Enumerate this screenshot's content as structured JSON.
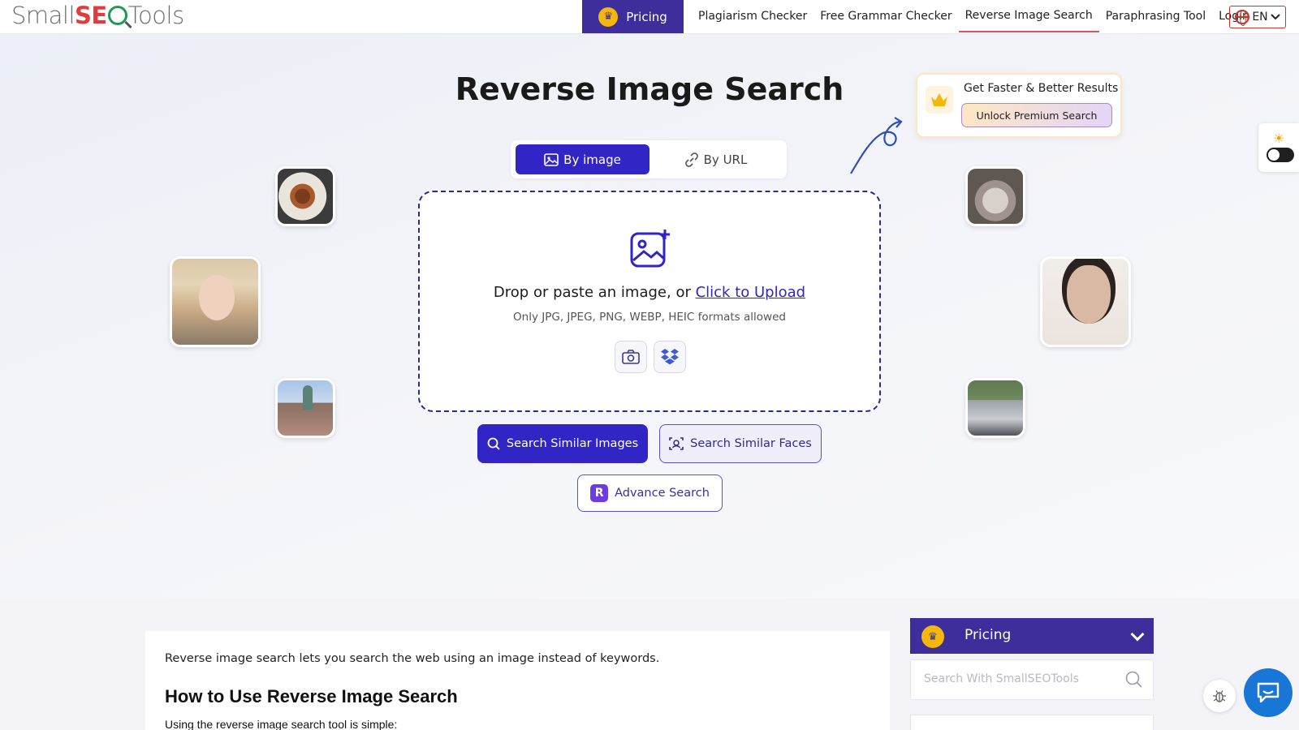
{
  "brand": {
    "name": "SmallSEOTools",
    "part1": "Small",
    "part2": "SE",
    "part3": "Tools"
  },
  "nav": {
    "pricing": "Pricing",
    "links": [
      "Plagiarism Checker",
      "Free Grammar Checker",
      "Reverse Image Search",
      "Paraphrasing Tool",
      "Login"
    ],
    "active": "Reverse Image Search",
    "language": "EN"
  },
  "hero": {
    "title": "Reverse Image Search",
    "tabs": {
      "by_image": "By image",
      "by_url": "By URL",
      "selected": "By image"
    },
    "dropzone": {
      "text": "Drop or paste an image, or",
      "link": "Click to Upload",
      "formats": "Only JPG, JPEG, PNG, WEBP, HEIC formats allowed"
    },
    "buttons": {
      "similar_images": "Search Similar Images",
      "similar_faces": "Search Similar Faces",
      "advance": "Advance Search"
    },
    "premium": {
      "title": "Get Faster & Better Results",
      "button": "Unlock Premium Search"
    }
  },
  "article": {
    "intro": "Reverse image search lets you search the web using an image instead of keywords.",
    "heading": "How to Use Reverse Image Search",
    "subtext": "Using the reverse image search tool is simple:"
  },
  "sidebar": {
    "pricing": "Pricing",
    "search_placeholder": "Search With SmallSEOTools"
  },
  "colors": {
    "primary": "#3126c5",
    "nav_purple": "#3d2e9b",
    "accent_gold": "#f5b70c",
    "chat_blue": "#1877d6"
  }
}
